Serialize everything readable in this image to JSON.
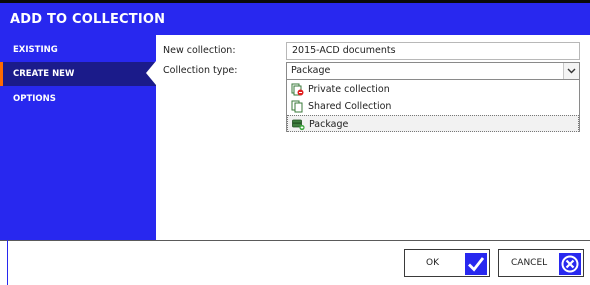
{
  "dialog": {
    "title": "ADD TO COLLECTION"
  },
  "sidebar": {
    "items": [
      {
        "label": "EXISTING"
      },
      {
        "label": "CREATE NEW"
      },
      {
        "label": "OPTIONS"
      }
    ],
    "active": "CREATE NEW",
    "accent_color": "#ff6a00",
    "background_color": "#2828ef"
  },
  "form": {
    "new_collection_label": "New collection:",
    "new_collection_value": "2015-ACD documents",
    "collection_type_label": "Collection type:",
    "collection_type_value": "Package",
    "collection_type_options": [
      {
        "label": "Private collection",
        "icon": "private-collection-icon"
      },
      {
        "label": "Shared Collection",
        "icon": "shared-collection-icon"
      },
      {
        "label": "Package",
        "icon": "package-icon",
        "selected": true
      }
    ]
  },
  "footer": {
    "ok_label": "OK",
    "cancel_label": "CANCEL"
  }
}
